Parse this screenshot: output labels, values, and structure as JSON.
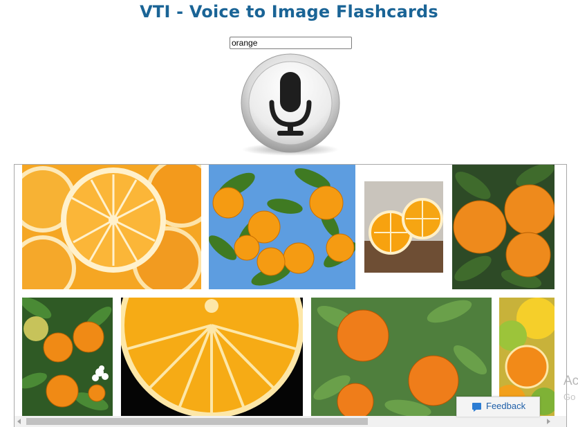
{
  "header": {
    "title": "VTI - Voice to Image Flashcards"
  },
  "search": {
    "value": "orange"
  },
  "mic": {
    "icon": "microphone-icon"
  },
  "results": {
    "images": [
      {
        "subject": "orange slices"
      },
      {
        "subject": "oranges on tree against blue sky"
      },
      {
        "subject": "halved orange on wooden board"
      },
      {
        "subject": "oranges with leaves"
      },
      {
        "subject": "oranges on branch with white blossom"
      },
      {
        "subject": "orange slice close-up on black"
      },
      {
        "subject": "oranges hanging on tree"
      },
      {
        "subject": "assorted citrus fruits"
      }
    ]
  },
  "feedback": {
    "label": "Feedback",
    "icon": "chat-bubble-icon"
  },
  "watermark": {
    "line1": "Ac",
    "line2": "Go"
  }
}
